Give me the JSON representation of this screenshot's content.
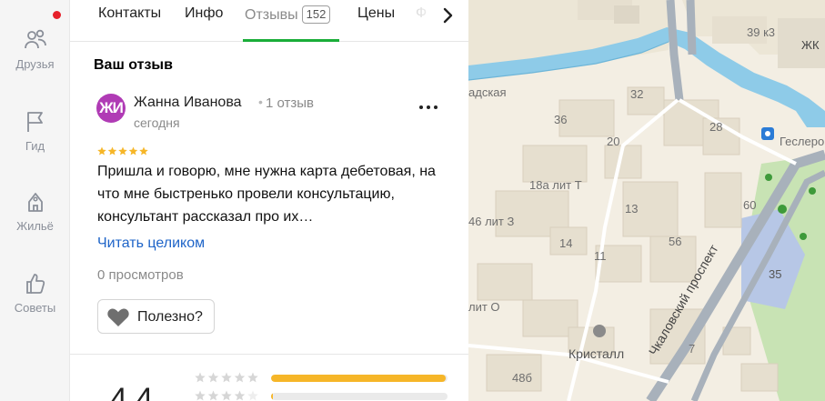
{
  "sidebar": {
    "items": [
      {
        "label": "Друзья",
        "icon": "friends-icon",
        "notification": true
      },
      {
        "label": "Гид",
        "icon": "flag-icon"
      },
      {
        "label": "Жильё",
        "icon": "house-icon"
      },
      {
        "label": "Советы",
        "icon": "thumbs-up-icon"
      }
    ]
  },
  "tabs": {
    "items": [
      "Контакты",
      "Инфо",
      "Отзывы",
      "Цены",
      "Ф"
    ],
    "active": "Отзывы",
    "reviews_count": "152"
  },
  "review_section": {
    "title": "Ваш отзыв",
    "avatar_initials": "ЖИ",
    "author": "Жанна Иванова",
    "author_reviews": "1 отзыв",
    "date": "сегодня",
    "rating": 5,
    "text": "Пришла и говорю, мне нужна карта дебетовая, на что мне быстренько провели консультацию, консультант рассказал про их…",
    "read_more": "Читать целиком",
    "views": "0 просмотров",
    "useful_label": "Полезно?"
  },
  "summary": {
    "rating": "4,4",
    "distribution": [
      {
        "stars": 5,
        "fraction": 0.99
      },
      {
        "stars": 4,
        "fraction": 0.01
      }
    ]
  },
  "map": {
    "labels": {
      "street_river": "адская",
      "chkalov": "Чкаловский проспект",
      "cristall": "Кристалл",
      "geslerovsky": "Геслеров",
      "zhk": "ЖК",
      "house_39": "39 к3",
      "house_32": "32",
      "house_36": "36",
      "house_28": "28",
      "house_20": "20",
      "house_18a": "18а лит Т",
      "house_46": "46 лит З",
      "house_13": "13",
      "house_60": "60",
      "house_14": "14",
      "house_56": "56",
      "house_11": "11",
      "house_35": "35",
      "house_o": "лит О",
      "house_7": "7",
      "house_48": "48б"
    },
    "colors": {
      "water": "#8ecbe8",
      "road": "#a8b1bb",
      "park": "#c8e3b4",
      "building": "#e6dfcf",
      "block": "#f3eee3"
    }
  }
}
